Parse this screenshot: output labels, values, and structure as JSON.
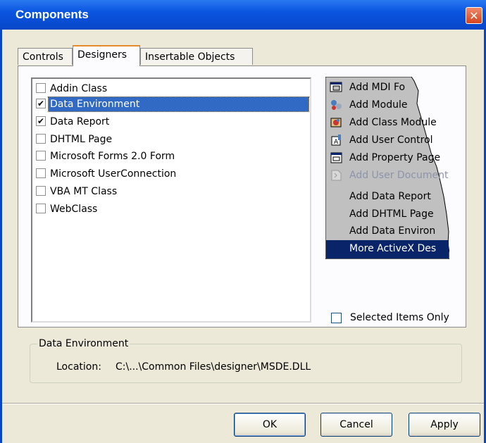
{
  "window": {
    "title": "Components",
    "close_glyph": "✕"
  },
  "tabs": [
    {
      "label": "Controls"
    },
    {
      "label": "Designers"
    },
    {
      "label": "Insertable Objects"
    }
  ],
  "designers": [
    {
      "label": "Addin Class",
      "checked": false
    },
    {
      "label": "Data Environment",
      "checked": true,
      "selected": true
    },
    {
      "label": "Data Report",
      "checked": true
    },
    {
      "label": "DHTML Page",
      "checked": false
    },
    {
      "label": "Microsoft Forms 2.0 Form",
      "checked": false
    },
    {
      "label": "Microsoft UserConnection",
      "checked": false
    },
    {
      "label": "VBA MT Class",
      "checked": false
    },
    {
      "label": "WebClass",
      "checked": false
    }
  ],
  "preview_menu": [
    {
      "label": "Add MDI Fo",
      "icon": "mdi-form-icon"
    },
    {
      "label": "Add Module",
      "icon": "module-icon"
    },
    {
      "label": "Add Class Module",
      "icon": "class-module-icon"
    },
    {
      "label": "Add User Control",
      "icon": "user-control-icon"
    },
    {
      "label": "Add Property Page",
      "icon": "property-page-icon"
    },
    {
      "label": "Add User Document",
      "icon": "user-document-icon",
      "disabled": true
    },
    {
      "label": "Add Data Report"
    },
    {
      "label": "Add DHTML Page"
    },
    {
      "label": "Add Data Environ"
    },
    {
      "label": "More ActiveX Des",
      "highlight": true
    }
  ],
  "selected_only": {
    "label": "Selected Items Only",
    "checked": false
  },
  "details": {
    "group_title": "Data Environment",
    "location_label": "Location:",
    "location_value": "C:\\...\\Common Files\\designer\\MSDE.DLL"
  },
  "buttons": {
    "ok": "OK",
    "cancel": "Cancel",
    "apply": "Apply"
  },
  "colors": {
    "title_bar": "#0a55e0",
    "selection": "#316ac5",
    "menu_bg": "#c0c0c0",
    "menu_highlight": "#0a246a",
    "tab_accent": "#e68b2c"
  }
}
